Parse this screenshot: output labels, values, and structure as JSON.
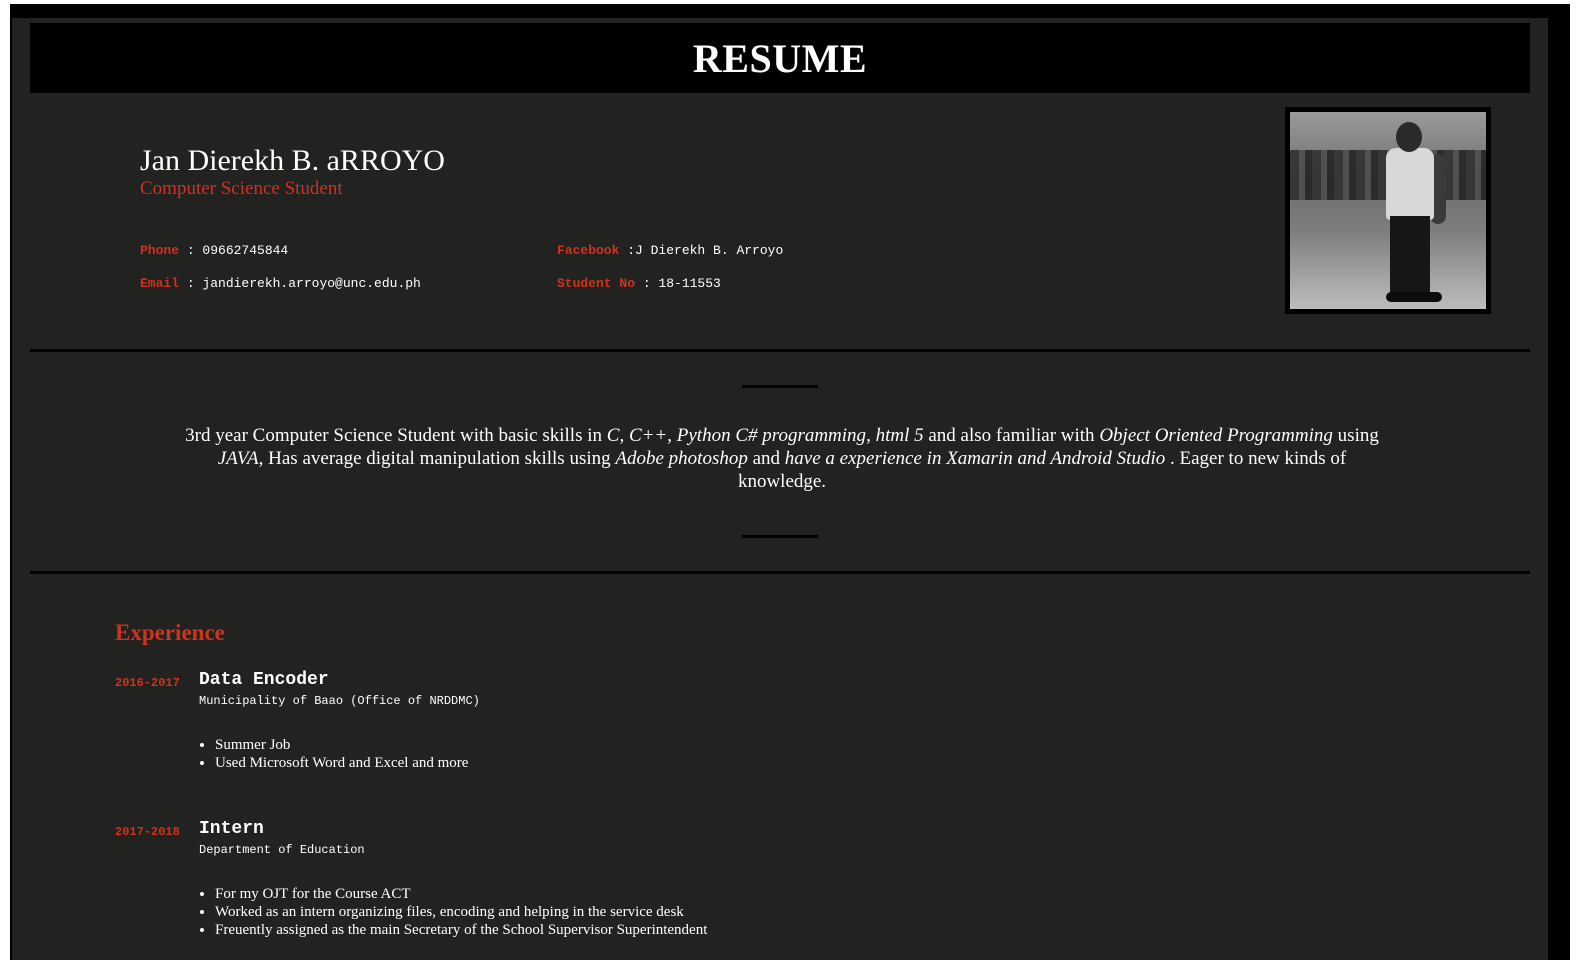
{
  "header": {
    "title": "RESUME"
  },
  "profile": {
    "name": "Jan Dierekh B. aRROYO",
    "role": "Computer Science Student"
  },
  "contacts": {
    "phone_label": "Phone",
    "phone_value": " : 09662745844",
    "email_label": "Email",
    "email_value": " : jandierekh.arroyo@unc.edu.ph",
    "facebook_label": "Facebook",
    "facebook_value": " :J Dierekh B. Arroyo",
    "student_label": "Student No",
    "student_value": " : 18-11553"
  },
  "summary": {
    "p1": "3rd year Computer Science Student with basic skills in ",
    "c": "C",
    "comma1": ", ",
    "cpp": "C++",
    "comma2": ", ",
    "python": "Python C# programming",
    "comma3": ", ",
    "html": "html 5",
    "p2": " and also familiar with ",
    "oop": "Object Oriented Programming",
    "p3": " using ",
    "java": "JAVA",
    "p4": ", Has average digital manipulation skills using ",
    "photoshop": "Adobe photoshop",
    "p5": " and ",
    "xamarin": "have a experience in Xamarin and Android Studio",
    "p6": " . Eager to new kinds of knowledge."
  },
  "experience": {
    "title": "Experience",
    "jobs": [
      {
        "years": "2016-2017",
        "title": "Data Encoder",
        "org": "Municipality of Baao (Office of NRDDMC)",
        "items": [
          "Summer Job",
          "Used Microsoft Word and Excel and more"
        ]
      },
      {
        "years": "2017-2018",
        "title": "Intern",
        "org": "Department of Education",
        "items": [
          "For my OJT for the Course ACT",
          "Worked as an intern organizing files, encoding and helping in the service desk",
          "Freuently assigned as the main Secretary of the School Supervisor Superintendent"
        ]
      }
    ]
  },
  "colors": {
    "accent": "#d0321e",
    "background": "#222220",
    "bar": "#000000",
    "text": "#ffffff"
  }
}
